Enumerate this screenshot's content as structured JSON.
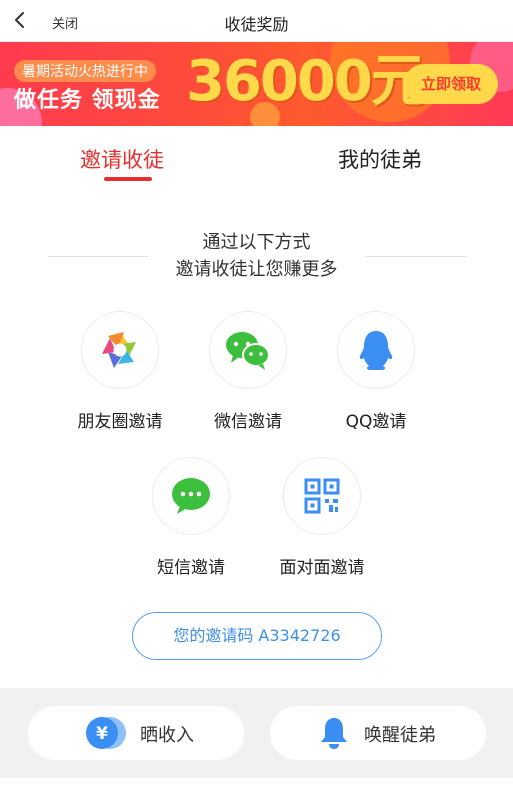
{
  "topbar": {
    "close_label": "关闭",
    "title": "收徒奖励"
  },
  "banner": {
    "tag": "暑期活动火热进行中",
    "headline": "做任务 领现金",
    "amount": "36000元",
    "claim_label": "立即领取"
  },
  "tabs": [
    {
      "label": "邀请收徒",
      "active": true
    },
    {
      "label": "我的徒弟",
      "active": false
    }
  ],
  "heading": {
    "line1": "通过以下方式",
    "line2": "邀请收徒让您赚更多"
  },
  "share": [
    {
      "label": "朋友圈邀请",
      "icon": "moments-icon"
    },
    {
      "label": "微信邀请",
      "icon": "wechat-icon"
    },
    {
      "label": "QQ邀请",
      "icon": "qq-icon"
    },
    {
      "label": "短信邀请",
      "icon": "sms-icon"
    },
    {
      "label": "面对面邀请",
      "icon": "qrcode-icon"
    }
  ],
  "invite": {
    "text": "您的邀请码 A3342726"
  },
  "bottom": {
    "income_label": "晒收入",
    "wake_label": "唤醒徒弟"
  },
  "colors": {
    "accent": "#e5302f",
    "link": "#3e8fe8",
    "wechat": "#3cbf3c",
    "qq": "#3b8ff2"
  }
}
